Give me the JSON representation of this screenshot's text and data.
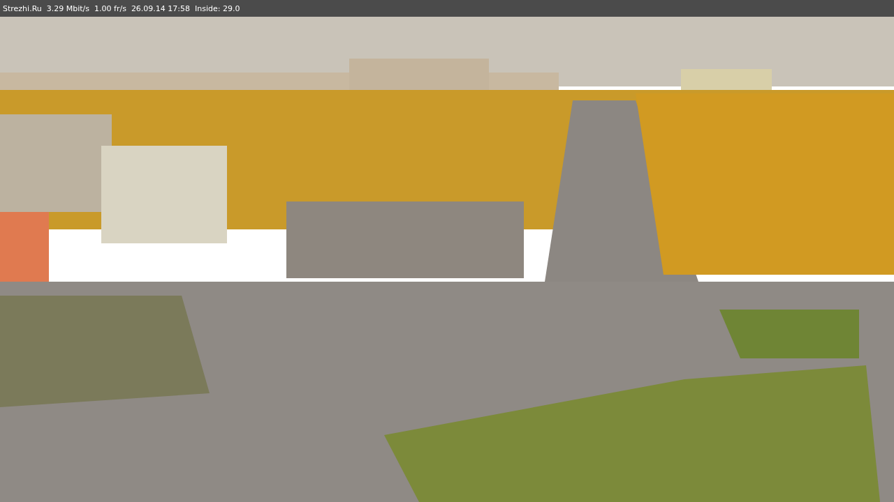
{
  "status_bar": {
    "items": [
      "Strezhi.Ru",
      "3.29 Mbit/s",
      "1.00 fr/s",
      "26.09.14 17:58",
      "Inside: 29.0"
    ]
  }
}
